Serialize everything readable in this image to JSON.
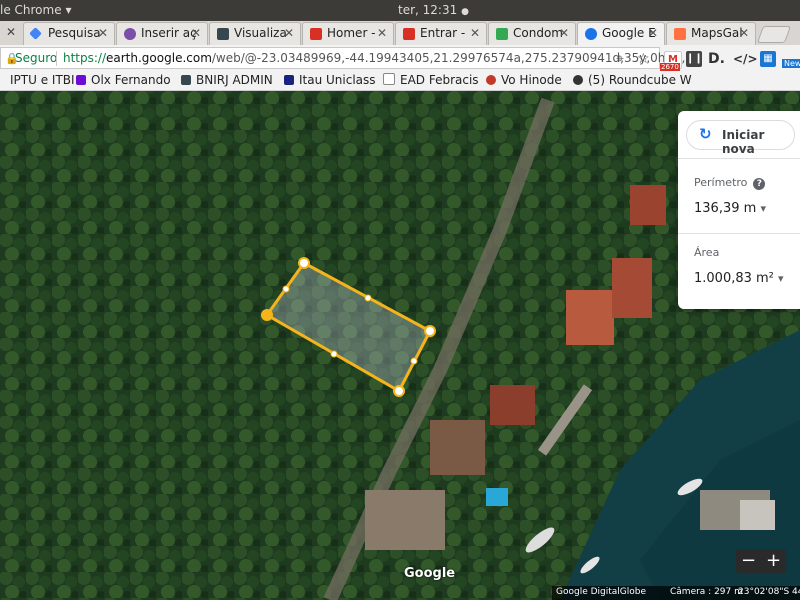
{
  "system": {
    "app_title": "le Chrome",
    "dropdown_icon": "▾",
    "clock": "ter, 12:31",
    "status_dot": "●"
  },
  "tabs": [
    {
      "label": "Pesquisa",
      "color": "#4285f4"
    },
    {
      "label": "Inserir aç",
      "color": "#7b4ea8"
    },
    {
      "label": "Visualiza",
      "color": "#37474f"
    },
    {
      "label": "Homer -",
      "color": "#d93025"
    },
    {
      "label": "Entrar -",
      "color": "#d93025"
    },
    {
      "label": "Condom",
      "color": "#34a853"
    },
    {
      "label": "Google E",
      "color": "#1a73e8"
    },
    {
      "label": "MapsGal",
      "color": "#ff7043"
    }
  ],
  "address": {
    "secure_label": "Seguro",
    "protocol": "https://",
    "domain": "earth.google.com",
    "path": "/web/@-23.03489969,-44.19943405,21.29976574a,275.23790941d,35y,0h,0t,0r"
  },
  "extensions": {
    "gmail_count": "2670",
    "new_badge": "New"
  },
  "bookmarks": [
    {
      "label": "IPTU e ITBI"
    },
    {
      "label": "Olx Fernando"
    },
    {
      "label": "BNIRJ ADMIN"
    },
    {
      "label": "Itau Uniclass"
    },
    {
      "label": "EAD Febracis"
    },
    {
      "label": "Vo Hinode"
    },
    {
      "label": "(5) Roundcube W"
    }
  ],
  "measure": {
    "new_button": "Iniciar nova",
    "perimeter_label": "Perímetro",
    "perimeter_value": "136,39 m",
    "area_label": "Área",
    "area_value": "1.000,83 m²",
    "help": "?",
    "dropdown": "▾"
  },
  "map": {
    "logo": "Google",
    "zoom_out": "−",
    "zoom_in": "+"
  },
  "attribution": {
    "imagery": "Google DigitalGlobe",
    "camera": "Câmera : 297 m",
    "coords": "23°02'08\"S 44"
  },
  "colors": {
    "polygon": "#f5b41b",
    "accent": "#1a73e8"
  }
}
